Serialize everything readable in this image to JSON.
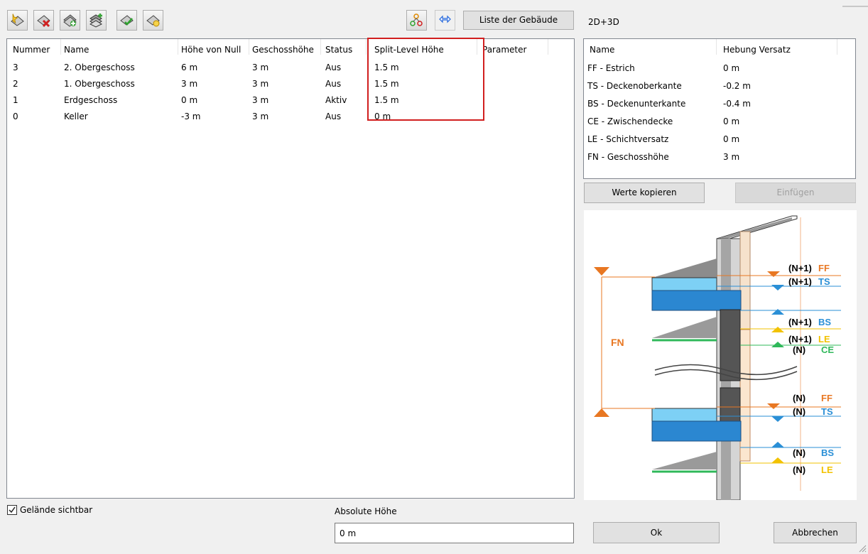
{
  "toolbar": {
    "icons": [
      "add-floor-icon",
      "delete-floor-icon",
      "duplicate-floor-icon",
      "add-multiple-floors-icon",
      "set-active-floor-icon",
      "floor-settings-icon"
    ],
    "tree_icon": "level-tree-icon",
    "arrows_icon": "swap-arrows-icon",
    "buildings_label": "Liste der Gebäude"
  },
  "right_title": "2D+3D",
  "table": {
    "columns": [
      "Nummer",
      "Name",
      "Höhe von Null",
      "Geschosshöhe",
      "Status",
      "Split-Level Höhe",
      "Parameter"
    ],
    "rows": [
      [
        "3",
        "2. Obergeschoss",
        "6 m",
        "3 m",
        "Aus",
        "1.5 m",
        ""
      ],
      [
        "2",
        "1. Obergeschoss",
        "3 m",
        "3 m",
        "Aus",
        "1.5 m",
        ""
      ],
      [
        "1",
        "Erdgeschoss",
        "0 m",
        "3 m",
        "Aktiv",
        "1.5 m",
        ""
      ],
      [
        "0",
        "Keller",
        "-3 m",
        "3 m",
        "Aus",
        "0 m",
        ""
      ]
    ],
    "highlight_color": "#d11f1f"
  },
  "offsets": {
    "columns": [
      "Name",
      "Hebung Versatz"
    ],
    "rows": [
      [
        "FF - Estrich",
        "0 m"
      ],
      [
        "TS - Deckenoberkante",
        "-0.2 m"
      ],
      [
        "BS - Deckenunterkante",
        "-0.4 m"
      ],
      [
        "CE - Zwischendecke",
        "0 m"
      ],
      [
        "LE - Schichtversatz",
        "0 m"
      ],
      [
        "FN - Geschosshöhe",
        "3 m"
      ]
    ]
  },
  "buttons": {
    "copy": "Werte kopieren",
    "paste": "Einfügen",
    "ok": "Ok",
    "cancel": "Abbrechen"
  },
  "terrain": {
    "label": "Gelände sichtbar",
    "checked": true
  },
  "absolute_height": {
    "label": "Absolute Höhe",
    "value": "0 m"
  },
  "diagram": {
    "fn": "FN",
    "n1": "(N+1)",
    "n": "(N)",
    "ff": "FF",
    "ts": "TS",
    "bs": "BS",
    "le": "LE",
    "ce": "CE",
    "colors": {
      "ff": "#e87722",
      "ts": "#2a8fd6",
      "bs": "#2a8fd6",
      "le": "#f2c200",
      "ce": "#2fb85a"
    }
  }
}
